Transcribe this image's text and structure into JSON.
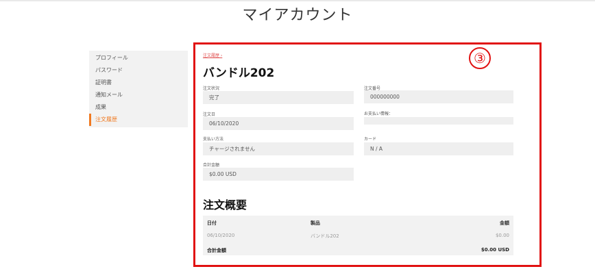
{
  "page": {
    "title": "マイアカウント"
  },
  "sidebar": {
    "items": [
      {
        "label": "プロフィール"
      },
      {
        "label": "パスワード"
      },
      {
        "label": "証明書"
      },
      {
        "label": "通知メール"
      },
      {
        "label": "成果"
      },
      {
        "label": "注文履歴",
        "active": true
      }
    ]
  },
  "annotation": {
    "number": "③",
    "color": "#e11111"
  },
  "order": {
    "breadcrumb": "注文履歴 ›",
    "title": "バンドル202",
    "fields": {
      "status": {
        "label": "注文状況",
        "value": "完了"
      },
      "order_number": {
        "label": "注文番号",
        "value": "000000000"
      },
      "order_date": {
        "label": "注文日",
        "value": "06/10/2020"
      },
      "payment_info": {
        "label": "お支払い情報：",
        "value": ""
      },
      "payment_method": {
        "label": "支払い方法",
        "value": "チャージされません"
      },
      "card": {
        "label": "カード",
        "value": "N / A"
      },
      "total": {
        "label": "合計金額",
        "value": "$0.00 USD"
      }
    }
  },
  "summary": {
    "title": "注文概要",
    "headers": {
      "date": "日付",
      "item": "製品",
      "amount": "金額"
    },
    "row": {
      "date": "06/10/2020",
      "item": "バンドル202",
      "amount": "$0.00"
    },
    "total_label": "合計金額",
    "total_value": "$0.00 USD"
  },
  "colors": {
    "accent": "#f07a22",
    "highlight": "#e11111",
    "field_bg": "#efefef"
  }
}
